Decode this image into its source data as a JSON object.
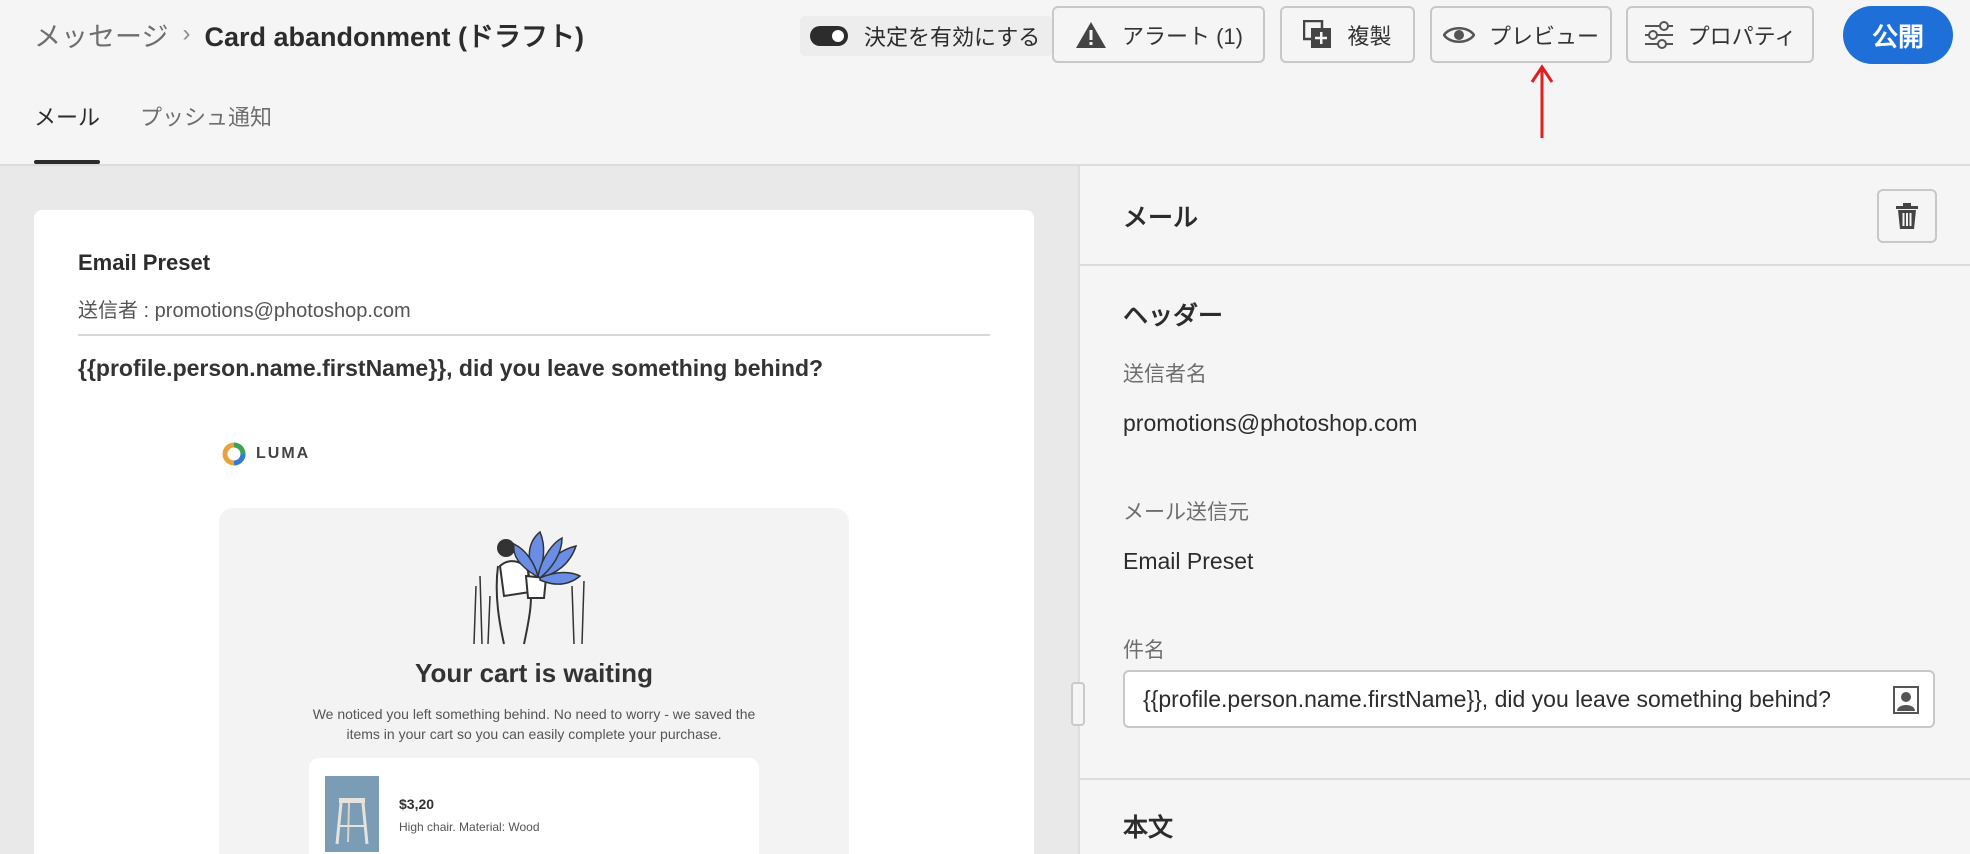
{
  "header": {
    "breadcrumb_parent": "メッセージ",
    "breadcrumb_sep": "›",
    "breadcrumb_title": "Card abandonment (ドラフト)",
    "toggle_label": "決定を有効にする",
    "alert_label": "アラート (1)",
    "duplicate_label": "複製",
    "preview_label": "プレビュー",
    "properties_label": "プロパティ",
    "publish_label": "公開"
  },
  "tabs": [
    {
      "label": "メール",
      "active": true
    },
    {
      "label": "プッシュ通知",
      "active": false
    }
  ],
  "email_preview": {
    "preset": "Email Preset",
    "sender": "送信者 : promotions@photoshop.com",
    "subject": "{{profile.person.name.firstName}}, did you leave something behind?",
    "logo_text": "LUMA",
    "headline": "Your cart is waiting",
    "description": "We noticed you left something behind. No need to worry - we saved the items in your cart so you can easily complete your purchase.",
    "product": {
      "price": "$3,20",
      "description": "High chair. Material: Wood"
    }
  },
  "properties_panel": {
    "title": "メール",
    "header_section": "ヘッダー",
    "sender_name_label": "送信者名",
    "sender_name_value": "promotions@photoshop.com",
    "email_from_label": "メール送信元",
    "email_from_value": "Email Preset",
    "subject_label": "件名",
    "subject_value": "{{profile.person.name.firstName}}, did you leave something behind?",
    "body_section": "本文"
  },
  "colors": {
    "accent": "#1f6fd9",
    "annotation": "#e02020"
  },
  "icons": [
    "alert-icon",
    "duplicate-icon",
    "eye-icon",
    "properties-icon",
    "trash-icon",
    "person-icon"
  ]
}
